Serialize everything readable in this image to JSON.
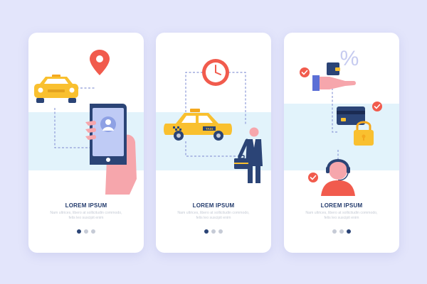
{
  "screens": [
    {
      "title": "LOREM IPSUM",
      "description": "Nam ultrices, libero at sollicitudin commodo, felis leo suscipit enim",
      "active_dot": 0,
      "dot_count": 3
    },
    {
      "title": "LOREM IPSUM",
      "description": "Nam ultrices, libero at sollicitudin commodo, felis leo suscipit enim",
      "active_dot": 0,
      "dot_count": 3
    },
    {
      "title": "LOREM IPSUM",
      "description": "Nam ultrices, libero at sollicitudin commodo, felis leo suscipit enim",
      "active_dot": 2,
      "dot_count": 3
    }
  ],
  "taxi_sign": "TAXI",
  "discount_symbol": "%",
  "icons": [
    "taxi-car-icon",
    "location-pin-icon",
    "smartphone-icon",
    "clock-icon",
    "businessman-icon",
    "briefcase-icon",
    "wallet-icon",
    "credit-card-icon",
    "padlock-icon",
    "check-icon",
    "support-agent-icon"
  ],
  "colors": {
    "background": "#e3e5fb",
    "navy": "#2b4476",
    "taxi_yellow": "#f9c02f",
    "accent_red": "#f15b4d",
    "band": "#e2f3fb"
  }
}
